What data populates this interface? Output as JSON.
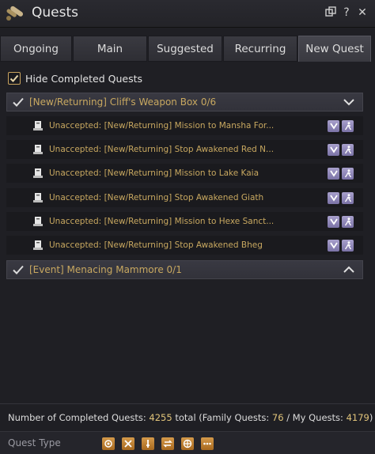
{
  "window": {
    "title": "Quests",
    "icons": [
      "scroll-icon",
      "popout-icon",
      "help-icon",
      "close-icon"
    ],
    "help_glyph": "?",
    "close_glyph": "✕"
  },
  "tabs": [
    {
      "label": "Ongoing",
      "active": false
    },
    {
      "label": "Main",
      "active": false
    },
    {
      "label": "Suggested",
      "active": false
    },
    {
      "label": "Recurring",
      "active": false
    },
    {
      "label": "New Quest",
      "active": true
    }
  ],
  "filter": {
    "hide_completed_label": "Hide Completed Quests",
    "checked": true
  },
  "groups": [
    {
      "title": "[New/Returning] Cliff's Weapon Box 0/6",
      "expanded": true,
      "quests": [
        {
          "text": "Unaccepted: [New/Returning] Mission to Mansha For..."
        },
        {
          "text": "Unaccepted: [New/Returning] Stop Awakened Red N..."
        },
        {
          "text": "Unaccepted: [New/Returning] Mission to Lake Kaia"
        },
        {
          "text": "Unaccepted: [New/Returning] Stop Awakened Giath"
        },
        {
          "text": "Unaccepted: [New/Returning] Mission to Hexe Sanct..."
        },
        {
          "text": "Unaccepted: [New/Returning] Stop Awakened Bheg"
        }
      ]
    },
    {
      "title": "[Event] Menacing Mammore 0/1",
      "expanded": false,
      "quests": []
    }
  ],
  "footer": {
    "prefix": "Number of Completed Quests: ",
    "total": "4255",
    "total_suffix": " total (Family Quests: ",
    "family": "76",
    "sep": " / My Quests: ",
    "mine": "4179",
    "close": ")"
  },
  "quest_type": {
    "label": "Quest Type",
    "icons": [
      "combat-type-icon",
      "crossed-swords-icon",
      "single-sword-icon",
      "trade-icon",
      "compass-icon",
      "more-icon"
    ]
  },
  "colors": {
    "accent_gold": "#c8a860",
    "number_gold": "#e1c47a",
    "row_button": "#8f87bb",
    "type_icon": "#c1823a"
  }
}
